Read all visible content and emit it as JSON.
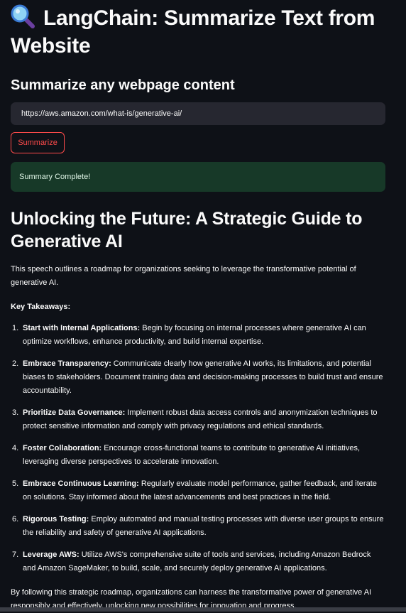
{
  "app": {
    "title": "LangChain: Summarize Text from Website",
    "title_icon": "magnifier-icon"
  },
  "form": {
    "subtitle": "Summarize any webpage content",
    "url_value": "https://aws.amazon.com/what-is/generative-ai/",
    "submit_label": "Summarize"
  },
  "status": {
    "message": "Summary Complete!",
    "color": "#173928"
  },
  "summary": {
    "heading": "Unlocking the Future: A Strategic Guide to Generative AI",
    "intro": "This speech outlines a roadmap for organizations seeking to leverage the transformative potential of generative AI.",
    "takeaways_label": "Key Takeaways:",
    "items": [
      {
        "num": "1.",
        "title": "Start with Internal Applications:",
        "text": " Begin by focusing on internal processes where generative AI can optimize workflows, enhance productivity, and build internal expertise."
      },
      {
        "num": "2.",
        "title": "Embrace Transparency:",
        "text": " Communicate clearly how generative AI works, its limitations, and potential biases to stakeholders. Document training data and decision-making processes to build trust and ensure accountability."
      },
      {
        "num": "3.",
        "title": "Prioritize Data Governance:",
        "text": " Implement robust data access controls and anonymization techniques to protect sensitive information and comply with privacy regulations and ethical standards."
      },
      {
        "num": "4.",
        "title": "Foster Collaboration:",
        "text": " Encourage cross-functional teams to contribute to generative AI initiatives, leveraging diverse perspectives to accelerate innovation."
      },
      {
        "num": "5.",
        "title": "Embrace Continuous Learning:",
        "text": " Regularly evaluate model performance, gather feedback, and iterate on solutions. Stay informed about the latest advancements and best practices in the field."
      },
      {
        "num": "6.",
        "title": "Rigorous Testing:",
        "text": " Employ automated and manual testing processes with diverse user groups to ensure the reliability and safety of generative AI applications."
      },
      {
        "num": "7.",
        "title": "Leverage AWS:",
        "text": " Utilize AWS's comprehensive suite of tools and services, including Amazon Bedrock and Amazon SageMaker, to build, scale, and securely deploy generative AI applications."
      }
    ],
    "outro": "By following this strategic roadmap, organizations can harness the transformative power of generative AI responsibly and effectively, unlocking new possibilities for innovation and progress."
  },
  "colors": {
    "background": "#0e1117",
    "accent": "#ff4b4b",
    "input_bg": "#262730"
  }
}
